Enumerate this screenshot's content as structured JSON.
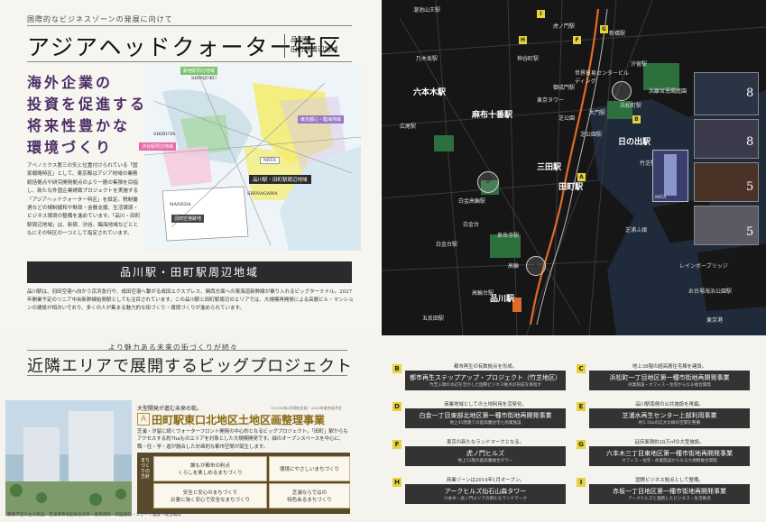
{
  "top_left": {
    "caption": "国際的なビジネスゾーンの発展に向けて",
    "title": "アジアヘッドクォーター特区",
    "subtitle_lines": [
      "品川駅・",
      "田町駅周辺地域"
    ],
    "catch_lines": [
      "海外企業の",
      "投資を促進する",
      "将来性豊かな",
      "環境づくり"
    ],
    "paragraph": "アベノミクス第三の矢と位置付けられている「国家戦略特区」として、東京都はアジア地域の業務統括拠点や研究開発拠点のより一層の集積を目指し、新たな外国企業誘致プロジェクトを実施する「アジアヘッドクォーター特区」を設定。税制優遇などの規制緩和や財政・金融支援、生活環境・ビジネス環境の整備を進めています。「品川・田町駅周辺地域」は、新宿、渋谷、臨海地域などとともにその特区の一つとして指定されています。",
    "area_labels": [
      "新宿駅周辺地域",
      "SHINJUKU",
      "渋谷駅周辺地域",
      "SHIBUYA",
      "東京都心・臨海地域",
      "品川駅・田町駅周辺地域",
      "SHINAGAWA",
      "羽田空港跡地",
      "HANEDA",
      "MITA"
    ],
    "band_title": "品川駅・田町駅周辺地域",
    "band_text": "品川駅は、羽田空港へ向かう京浜急行や、成田空港へ繋がる成田エクスプレス、関西方面への東海道新幹線が乗り入れるビッグターミナル。2027年開業予定のリニア中央新幹線始発駅としても注目されています。この品川駅と田町駅周辺のエリアでは、大規模再開発による高層ビル・マンションの建設が相次いでおり、多くの人が集まる魅力的な街づくり・環境づくりが進められています。"
  },
  "map": {
    "stations": [
      {
        "name": "溜池山王駅",
        "big": false
      },
      {
        "name": "乃木坂駅",
        "big": false
      },
      {
        "name": "六本木駅",
        "big": false
      },
      {
        "name": "麻布十番駅",
        "big": false
      },
      {
        "name": "広尾駅",
        "big": false
      },
      {
        "name": "白金高輪駅",
        "big": false
      },
      {
        "name": "白金台駅",
        "big": false
      },
      {
        "name": "泉岳寺駅",
        "big": false
      },
      {
        "name": "高輪台駅",
        "big": false
      },
      {
        "name": "五反田駅",
        "big": false
      },
      {
        "name": "品川駅",
        "big": true
      },
      {
        "name": "田町駅",
        "big": true
      },
      {
        "name": "三田駅",
        "big": true
      },
      {
        "name": "大門駅",
        "big": false
      },
      {
        "name": "浜松町駅",
        "big": false
      },
      {
        "name": "汐留駅",
        "big": false
      },
      {
        "name": "日の出駅",
        "big": true
      },
      {
        "name": "芝公園駅",
        "big": false
      },
      {
        "name": "御成門駅",
        "big": false
      },
      {
        "name": "神谷町駅",
        "big": false
      },
      {
        "name": "虎ノ門駅",
        "big": false
      },
      {
        "name": "新橋駅",
        "big": false
      },
      {
        "name": "竹芝駅",
        "big": false
      },
      {
        "name": "お台場海浜公園駅",
        "big": false
      }
    ],
    "landmarks": [
      "東京タワー",
      "芝公園",
      "浜離宮恩賜庭園",
      "世界貿易センタービルディング",
      "白金台",
      "高輪",
      "芝浦ふ頭",
      "レインボーブリッジ",
      "東京港"
    ],
    "markers": [
      "H",
      "D",
      "F",
      "G",
      "B",
      "C",
      "A",
      "E",
      "I"
    ],
    "photo_numbers": [
      "8",
      "8",
      "5",
      "5"
    ],
    "building_label": "MITA"
  },
  "bottom_left": {
    "caption": "より魅力ある未来の街づくりが続々",
    "title": "近隣エリアで展開するビッグプロジェクト",
    "project_sub": "大型開発が進む未来の街。",
    "project_note": "※2015年6月現在計画・2020年度完成予定",
    "project_letter": "A",
    "project_title": "田町駅東口北地区土地区画整理事業",
    "project_text": "芝浦・汐留に続くウォーターフロント開発の中心的となるビッグプロジェクト。「田町」駅からもアクセスする約7haものエリアを対象とした大規模開発です。緑のオープンスペースを中心に、職・住・学・遊が融合した計画的な都市空間が誕生します。",
    "concept_label": "まちづくりの方針",
    "features": [
      {
        "l1": "誰もが都市の利点",
        "l2": "くらしを楽しめるまちづくり"
      },
      {
        "l1": "環境にやさしいまちづくり",
        "l2": ""
      },
      {
        "l1": "安全と安心のまちづくり",
        "l2": "災害に強く安心で安全なまちづくり"
      },
      {
        "l1": "芝浦ならではの",
        "l2": "特色あるまちづくり"
      }
    ],
    "footer": "整備予定の主な施設：芝浦港南地区総合支所・愛育病院・新図書館・スポーツ施設・総合病院"
  },
  "projects": [
    {
      "letter": "B",
      "note": "都市再生の有数拠点を形成。",
      "title": "都市再生ステップアップ・プロジェクト（竹芝地区）",
      "desc": "竹芝ふ頭の水辺を活かした国際ビジネス拠点の形成を目指す"
    },
    {
      "letter": "C",
      "note": "地上38階の超高層住宅棟を建設。",
      "title": "浜松町一丁目地区第一種市街地再開発事業",
      "desc": "商業施設・オフィス・住宅からなる複合開発"
    },
    {
      "letter": "D",
      "note": "商業地域としての土地利用を活発化。",
      "title": "白金一丁目東部北地区第一種市街地再開発事業",
      "desc": "地上45階建ての超高層住宅と商業施設"
    },
    {
      "letter": "E",
      "note": "品川駅南側の公共施設を再編。",
      "title": "芝浦水再生センター上部利用事業",
      "desc": "約5.3haの広大な緑の空間を整備"
    },
    {
      "letter": "F",
      "note": "東京の新たなランドマークとなる。",
      "title": "虎ノ門ヒルズ",
      "desc": "地上52階の超高層複合タワー"
    },
    {
      "letter": "G",
      "note": "延床面積約28万㎡の大型施設。",
      "title": "六本木三丁目東地区第一種市街地再開発事業",
      "desc": "オフィス・住宅・商業施設からなる大規模複合開発"
    },
    {
      "letter": "H",
      "note": "商業ゾーンは2014年1月オープン。",
      "title": "アークヒルズ仙石山森タワー",
      "desc": "六本木・虎ノ門エリアの新たなランドマーク"
    },
    {
      "letter": "I",
      "note": "国際ビジネス拠点として整備。",
      "title": "赤坂一丁目地区第一種市街地再開発事業",
      "desc": "アークヒルズと連携したビジネス・生活拠点"
    }
  ]
}
